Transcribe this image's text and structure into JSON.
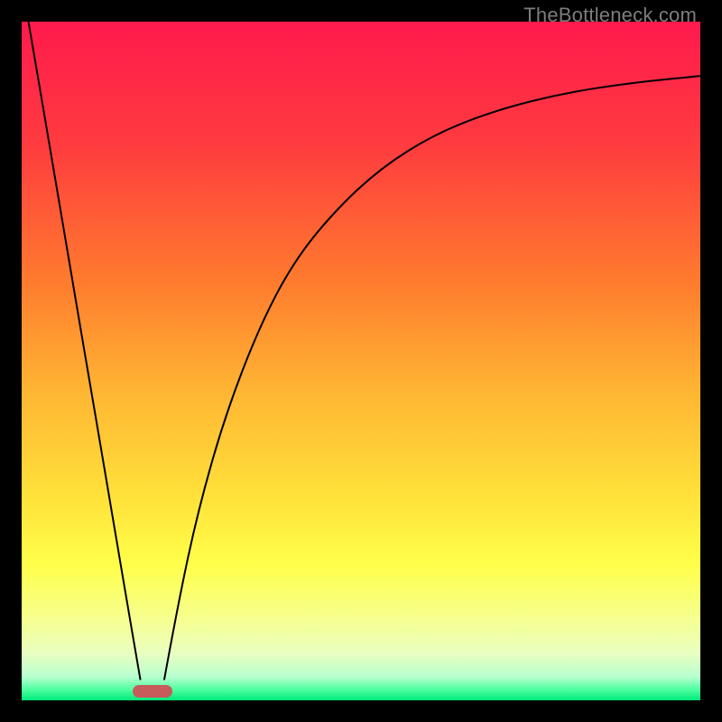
{
  "watermark": "TheBottleneck.com",
  "chart_data": {
    "type": "line",
    "title": "",
    "xlabel": "",
    "ylabel": "",
    "x_range": [
      0,
      100
    ],
    "y_range": [
      0,
      100
    ],
    "gradient_stops": [
      {
        "offset": 0.0,
        "color": "#ff1a4d"
      },
      {
        "offset": 0.18,
        "color": "#ff3b3f"
      },
      {
        "offset": 0.38,
        "color": "#ff7a2e"
      },
      {
        "offset": 0.55,
        "color": "#ffb733"
      },
      {
        "offset": 0.7,
        "color": "#ffe13a"
      },
      {
        "offset": 0.8,
        "color": "#ffff4a"
      },
      {
        "offset": 0.88,
        "color": "#f6ff8f"
      },
      {
        "offset": 0.93,
        "color": "#eaffc0"
      },
      {
        "offset": 0.965,
        "color": "#b8ffcf"
      },
      {
        "offset": 0.985,
        "color": "#49ff9e"
      },
      {
        "offset": 1.0,
        "color": "#00e878"
      }
    ],
    "series": [
      {
        "name": "left-branch",
        "x": [
          1,
          3,
          5,
          7,
          9,
          11,
          13,
          15,
          16.5,
          17.5
        ],
        "y": [
          100,
          88.3,
          76.5,
          64.7,
          52.9,
          41.2,
          29.4,
          17.6,
          8.8,
          3
        ]
      },
      {
        "name": "right-branch",
        "x": [
          21,
          23,
          26,
          30,
          35,
          40,
          46,
          53,
          61,
          70,
          80,
          90,
          100
        ],
        "y": [
          3,
          14,
          28,
          42,
          55,
          64.5,
          72,
          78.5,
          83.5,
          87,
          89.5,
          91,
          92
        ]
      }
    ],
    "marker": {
      "x": 19.3,
      "y": 1.3,
      "color": "#c75b5b"
    }
  }
}
